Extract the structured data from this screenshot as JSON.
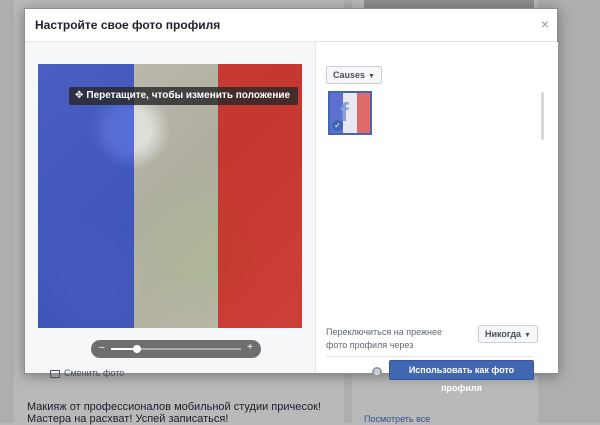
{
  "background": {
    "post_text": "Макияж от профессионалов мобильной студии причесок!\nМастера на расхват! Успей записаться!",
    "see_all_link": "Посмотреть все"
  },
  "modal": {
    "title": "Настройте свое фото профиля",
    "close_glyph": "×"
  },
  "preview": {
    "drag_hint": "Перетащите, чтобы изменить положение",
    "move_icon_glyph": "✥",
    "zoom_level": 0.2,
    "zoom_minus": "–",
    "zoom_plus": "+",
    "change_photo_label": "Сменить фото"
  },
  "frames": {
    "category_label": "Causes",
    "selected_frame": "French flag overlay",
    "check_glyph": "✓"
  },
  "revert": {
    "label": "Переключиться на прежнее фото профиля через",
    "option": "Никогда"
  },
  "actions": {
    "use_button": "Использовать как фото профиля",
    "privacy_icon": "globe-icon"
  },
  "colors": {
    "flag_blue": "#2846dc",
    "flag_white": "#ebebeb",
    "flag_red": "#e11e1e",
    "primary_button": "#4267b2"
  }
}
